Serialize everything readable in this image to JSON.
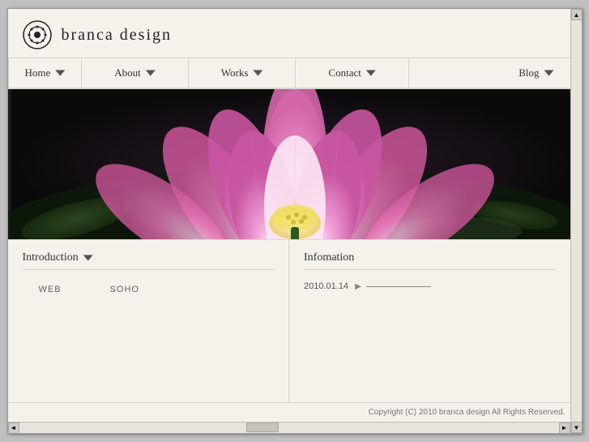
{
  "site": {
    "title": "branca design",
    "logo_alt": "branca design logo"
  },
  "nav": {
    "items": [
      {
        "label": "Home",
        "has_arrow": true
      },
      {
        "label": "About",
        "has_arrow": true
      },
      {
        "label": "Works",
        "has_arrow": true
      },
      {
        "label": "Contact",
        "has_arrow": true
      },
      {
        "label": "Blog",
        "has_arrow": true
      }
    ]
  },
  "sections": {
    "intro": {
      "title": "Introduction",
      "links": [
        "WEB",
        "SOHO"
      ]
    },
    "info": {
      "title": "Infomation",
      "entries": [
        {
          "date": "2010.01.14",
          "text": ""
        }
      ]
    }
  },
  "footer": {
    "copyright": "Copyright (C) 2010 branca design All Rights Reserved."
  }
}
